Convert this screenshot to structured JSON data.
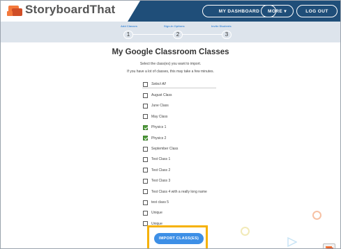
{
  "header": {
    "brand": "StoryboardThat",
    "dashboard_label": "MY DASHBOARD",
    "more_label": "MORE ▾",
    "logout_label": "LOG OUT"
  },
  "steps": [
    {
      "label": "Add Classes",
      "number": "1"
    },
    {
      "label": "Sign-In Options",
      "number": "2"
    },
    {
      "label": "Invite Students",
      "number": "3"
    }
  ],
  "main": {
    "title": "My Google Classroom Classes",
    "instruction1": "Select the class(es) you want to import.",
    "instruction2": "If you have a lot of classes, this may take a few minutes.",
    "select_all_label": "Select All",
    "classes": [
      {
        "label": "August Class",
        "checked": false
      },
      {
        "label": "June Class",
        "checked": false
      },
      {
        "label": "May Class",
        "checked": false
      },
      {
        "label": "Physics 1",
        "checked": true
      },
      {
        "label": "Physics 2",
        "checked": true
      },
      {
        "label": "September Class",
        "checked": false
      },
      {
        "label": "Test Class 1",
        "checked": false
      },
      {
        "label": "Test Class 2",
        "checked": false
      },
      {
        "label": "Test Class 3",
        "checked": false
      },
      {
        "label": "Test Class 4 with a really long name",
        "checked": false
      },
      {
        "label": "test class 5",
        "checked": false
      },
      {
        "label": "Unique",
        "checked": false
      },
      {
        "label": "Unique",
        "checked": false
      }
    ],
    "import_label": "IMPORT CLASS(ES)"
  },
  "colors": {
    "header_bg": "#1f4e79",
    "steps_bg": "#dde4ec",
    "accent_blue": "#3d8fe6",
    "check_green": "#4e9a3a",
    "highlight": "#f6b100",
    "logo_orange": "#f4793b"
  }
}
